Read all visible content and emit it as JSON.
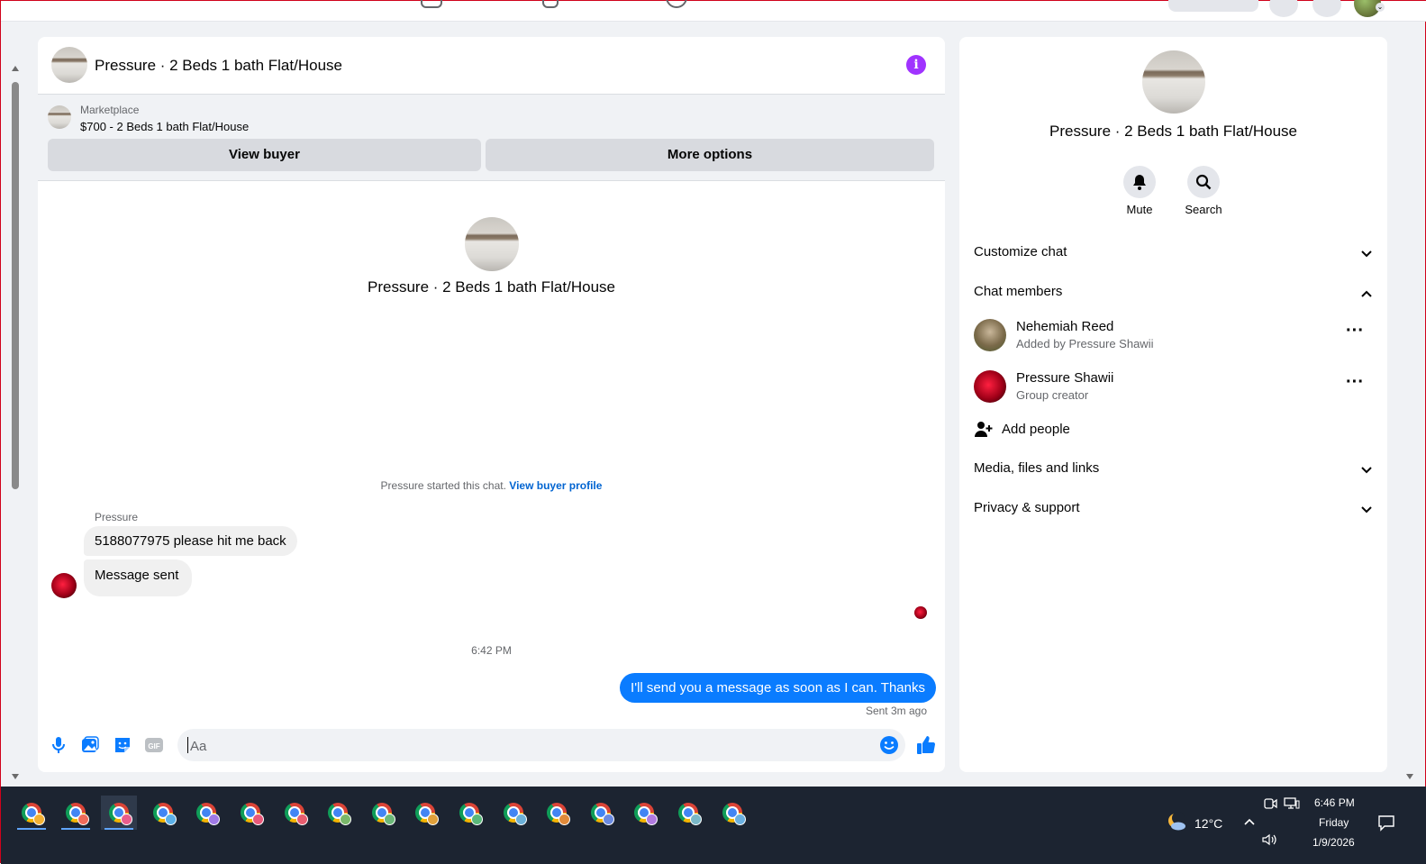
{
  "chat": {
    "title": "Pressure · 2 Beds 1 bath Flat/House",
    "marketplace_label": "Marketplace",
    "marketplace_item": "$700 - 2 Beds 1 bath Flat/House",
    "view_buyer_label": "View buyer",
    "more_options_label": "More options",
    "center_title": "Pressure · 2 Beds 1 bath Flat/House",
    "started_text": "Pressure started this chat.",
    "view_buyer_profile_link": "View buyer profile",
    "sender_name": "Pressure",
    "messages_in": [
      "5188077975 please hit me back",
      "Message sent"
    ],
    "time_separator": "6:42 PM",
    "message_out": "I'll send you a message as soon as I can. Thanks",
    "sent_status": "Sent 3m ago",
    "composer_placeholder": "Aa",
    "accent_color": "#0a7cff",
    "info_color": "#a033ff"
  },
  "side": {
    "title": "Pressure · 2 Beds 1 bath Flat/House",
    "mute_label": "Mute",
    "search_label": "Search",
    "customize_chat": "Customize chat",
    "chat_members": "Chat members",
    "members": [
      {
        "name": "Nehemiah Reed",
        "sub": "Added by Pressure Shawii"
      },
      {
        "name": "Pressure Shawii",
        "sub": "Group creator"
      }
    ],
    "add_people": "Add people",
    "media_files_links": "Media, files and links",
    "privacy_support": "Privacy & support"
  },
  "taskbar": {
    "temperature": "12°C",
    "time": "6:46 PM",
    "day": "Friday",
    "date": "1/9/2026",
    "chrome_badge_colors": [
      "#f2b134",
      "#f06b5a",
      "#e85d8c",
      "#5bb0e8",
      "#9f7ae6",
      "#e8587a",
      "#e85d6f",
      "#7ab86a",
      "#6bb878",
      "#e0a03a",
      "#5ab87a",
      "#6bb0d8",
      "#e08a3a",
      "#6a8ae0",
      "#b07ae0",
      "#7ab8c8",
      "#6ab0e0"
    ]
  }
}
